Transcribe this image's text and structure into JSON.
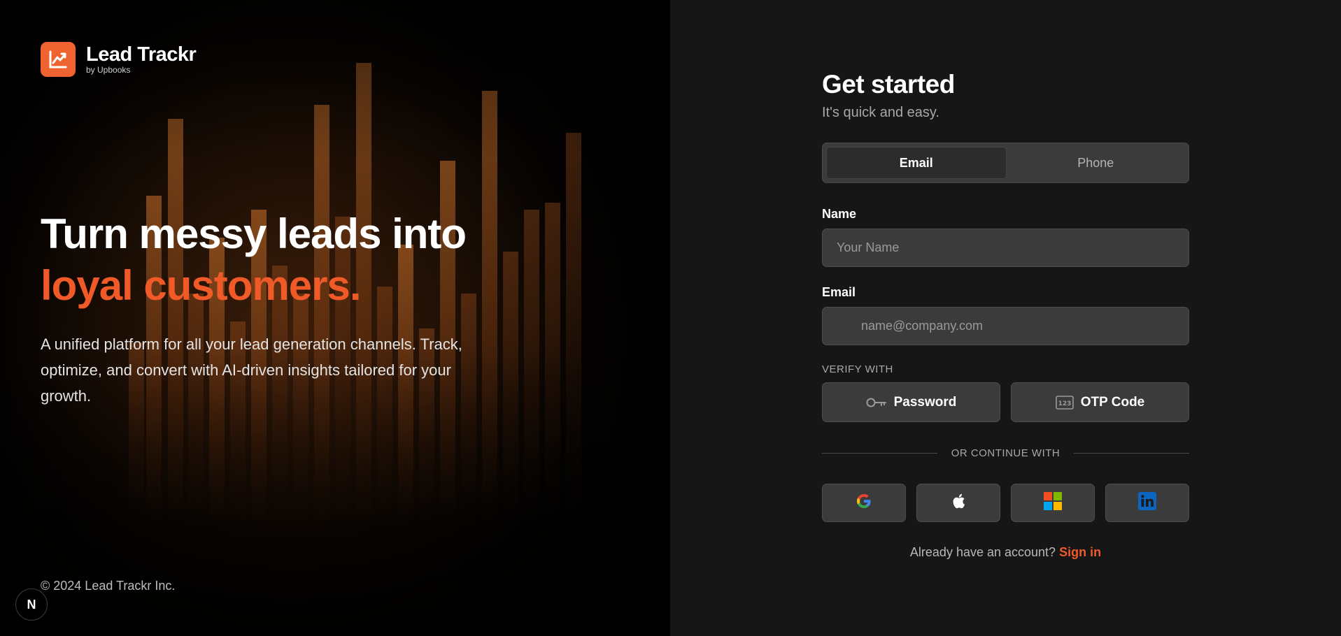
{
  "brand": {
    "name": "Lead Trackr",
    "sub": "by Upbooks",
    "logo_icon": "trending-chart-icon",
    "accent_color": "#ef6330"
  },
  "hero": {
    "headline_line1": "Turn messy leads into",
    "headline_line2": "loyal customers.",
    "description": "A unified platform for all your lead generation channels. Track, optimize, and convert with AI-driven insights tailored for your growth."
  },
  "footer": {
    "copyright": "© 2024 Lead Trackr Inc.",
    "badge": "N"
  },
  "form": {
    "title": "Get started",
    "subtitle": "It's quick and easy.",
    "tabs": [
      {
        "label": "Email",
        "active": true
      },
      {
        "label": "Phone",
        "active": false
      }
    ],
    "name_label": "Name",
    "name_placeholder": "Your Name",
    "email_label": "Email",
    "email_placeholder": "name@company.com",
    "verify_label": "VERIFY WITH",
    "verify_options": [
      {
        "label": "Password",
        "icon": "key-icon"
      },
      {
        "label": "OTP Code",
        "icon": "otp-123-icon"
      }
    ],
    "divider_text": "OR CONTINUE WITH",
    "social": [
      "google-icon",
      "apple-icon",
      "microsoft-icon",
      "linkedin-icon"
    ],
    "signin_prompt": "Already have an account?",
    "signin_link": "Sign in"
  }
}
